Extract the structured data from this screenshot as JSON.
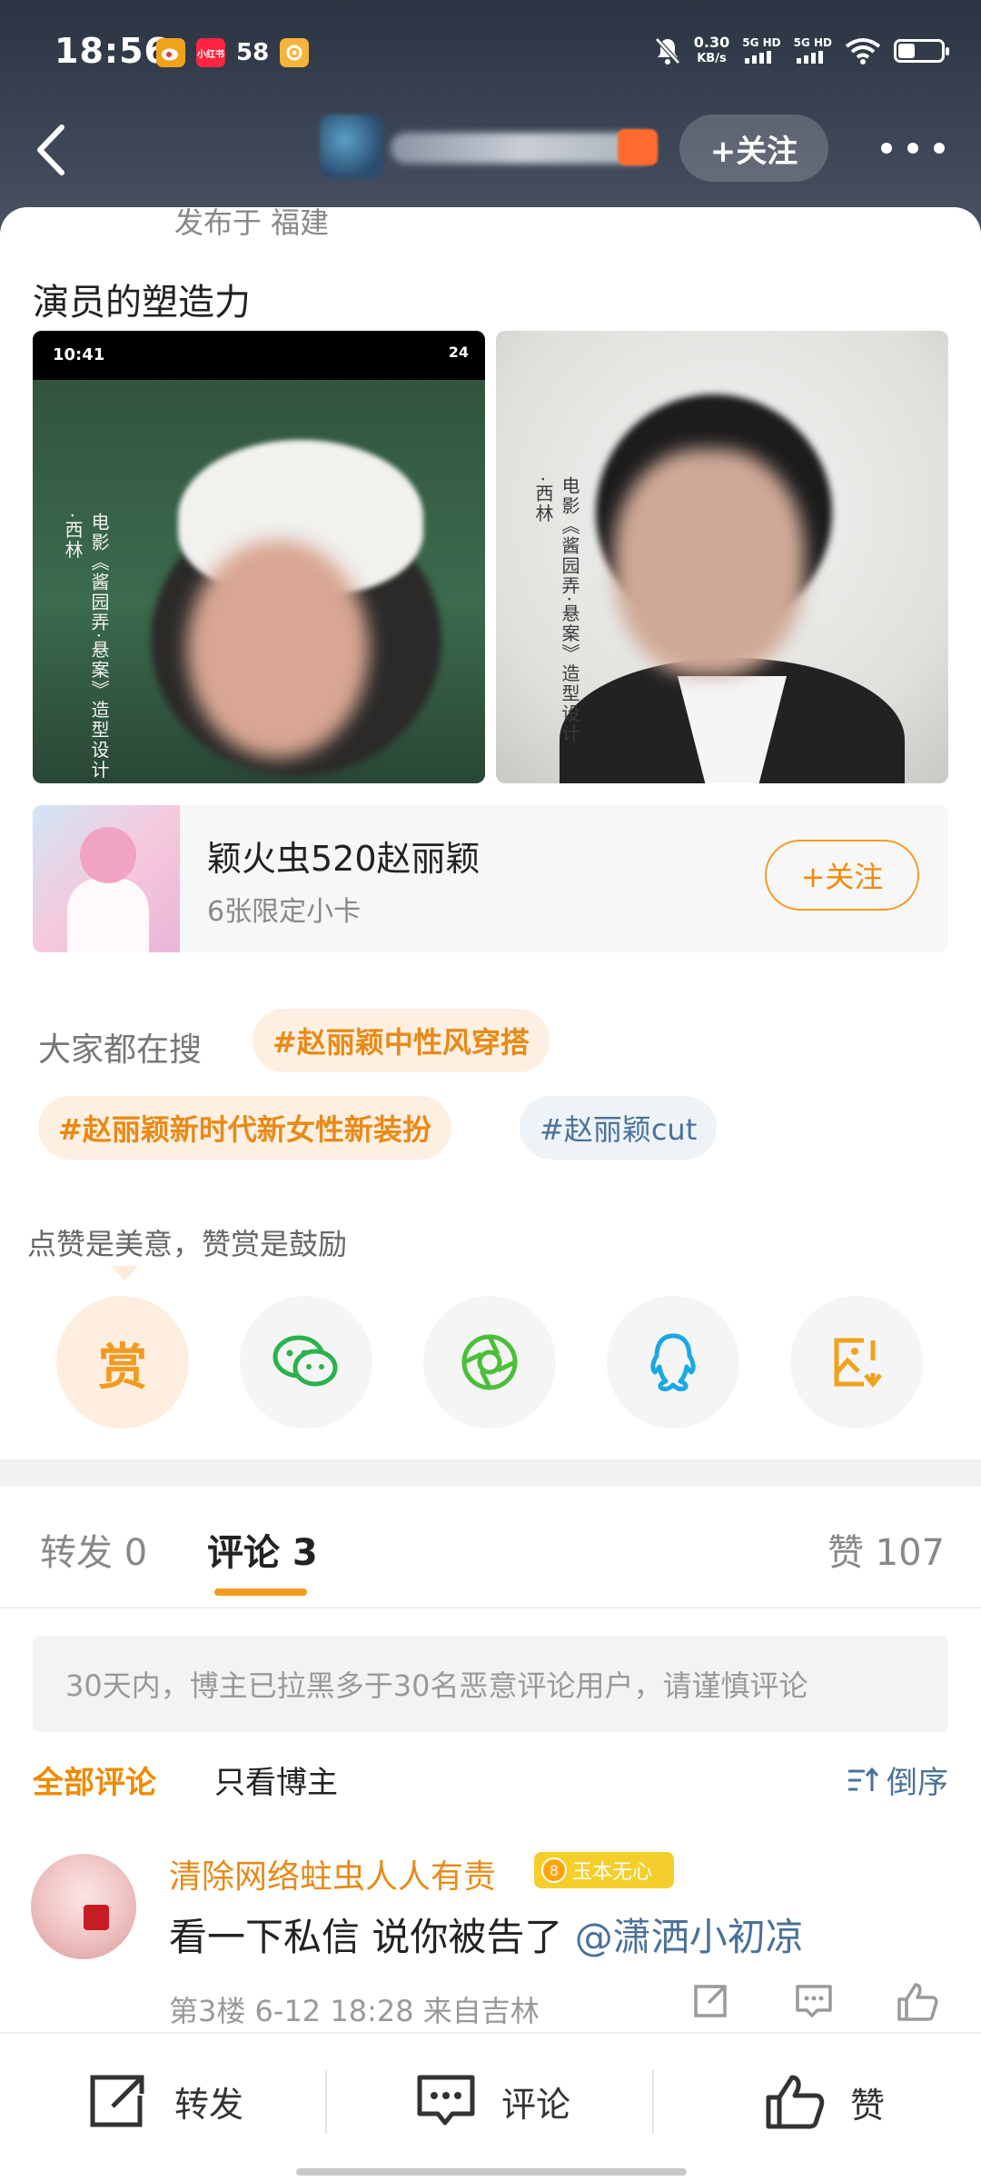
{
  "status_bar": {
    "time": "18:56",
    "net_speed_value": "0.30",
    "net_speed_unit": "KB/s",
    "network_1": "5G HD",
    "network_2": "5G HD",
    "app_icons": [
      "weibo-icon",
      "xiaohongshu-icon",
      "58-icon",
      "camera-app-icon"
    ],
    "app_58_label": "58",
    "app_xhs_label": "小红书",
    "battery_level": 0.36
  },
  "nav": {
    "follow_label": "+关注"
  },
  "post": {
    "location": "发布于 福建",
    "text": "演员的塑造力",
    "photos": [
      {
        "status_time": "10:41",
        "status_right": "24",
        "vertical_caption": "电影《酱园弄·悬案》造型设计·西林"
      },
      {
        "vertical_caption": "电影《酱园弄·悬案》造型设计·西林"
      }
    ]
  },
  "promo": {
    "title": "颖火虫520赵丽颖",
    "subtitle": "6张限定小卡",
    "follow_label": "+关注"
  },
  "search": {
    "label": "大家都在搜",
    "tags": [
      "#赵丽颖中性风穿搭",
      "#赵丽颖新时代新女性新装扮",
      "#赵丽颖cut"
    ]
  },
  "reward": {
    "tip": "点赞是美意，赞赏是鼓励",
    "reward_label": "赏",
    "share_targets": [
      "wechat-icon",
      "moments-icon",
      "qq-icon",
      "save-image-icon"
    ]
  },
  "tabs": {
    "repost": "转发 0",
    "comments": "评论 3",
    "likes": "赞 107"
  },
  "notice": "30天内，博主已拉黑多于30名恶意评论用户，请谨慎评论",
  "filters": {
    "all": "全部评论",
    "owner_only": "只看博主",
    "sort": "倒序"
  },
  "comment": {
    "username": "清除网络蛀虫人人有责",
    "badge_level": "8",
    "badge_text": "玉本无心",
    "text": "看一下私信 说你被告了 ",
    "mention": "@潇洒小初凉",
    "meta": "第3楼 6-12 18:28 来自吉林"
  },
  "bottom_bar": {
    "repost": "转发",
    "comment": "评论",
    "like": "赞"
  },
  "colors": {
    "accent_orange": "#F49B1E",
    "link_blue": "#4A7299",
    "badge_yellow": "#F4CF2B"
  }
}
